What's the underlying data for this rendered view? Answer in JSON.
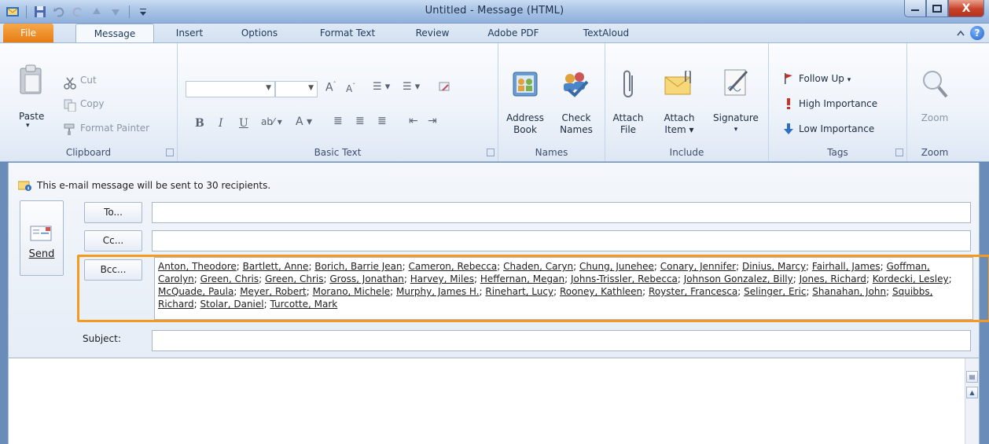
{
  "window": {
    "title": "Untitled - Message (HTML)",
    "close_glyph": "X"
  },
  "tabs": {
    "file": "File",
    "message": "Message",
    "insert": "Insert",
    "options": "Options",
    "format_text": "Format Text",
    "review": "Review",
    "adobe_pdf": "Adobe PDF",
    "textaloud": "TextAloud",
    "help_glyph": "?"
  },
  "ribbon": {
    "clipboard": {
      "label": "Clipboard",
      "paste": "Paste",
      "cut": "Cut",
      "copy": "Copy",
      "format_painter": "Format Painter"
    },
    "basic_text": {
      "label": "Basic Text"
    },
    "names": {
      "label": "Names",
      "address_book_1": "Address",
      "address_book_2": "Book",
      "check_names_1": "Check",
      "check_names_2": "Names"
    },
    "include": {
      "label": "Include",
      "attach_file_1": "Attach",
      "attach_file_2": "File",
      "attach_item_1": "Attach",
      "attach_item_2": "Item",
      "signature": "Signature"
    },
    "tags": {
      "label": "Tags",
      "follow_up": "Follow Up",
      "high_importance": "High Importance",
      "low_importance": "Low Importance"
    },
    "zoom": {
      "label": "Zoom",
      "zoom_btn": "Zoom"
    }
  },
  "compose": {
    "info": "This e-mail message will be sent to 30 recipients.",
    "send": "Send",
    "to_btn": "To...",
    "cc_btn": "Cc...",
    "bcc_btn": "Bcc...",
    "subject_label": "Subject:",
    "bcc_recipients": [
      "Anton, Theodore",
      "Bartlett, Anne",
      "Borich, Barrie Jean",
      "Cameron, Rebecca",
      "Chaden, Caryn",
      "Chung, Junehee",
      "Conary, Jennifer",
      "Dinius, Marcy",
      "Fairhall, James",
      "Goffman, Carolyn",
      "Green, Chris",
      "Green, Chris",
      "Gross, Jonathan",
      "Harvey, Miles",
      "Heffernan, Megan",
      "Johns-Trissler, Rebecca",
      "Johnson Gonzalez, Billy",
      "Jones, Richard",
      "Kordecki, Lesley",
      "McQuade, Paula",
      "Meyer, Robert",
      "Morano, Michele",
      "Murphy, James H.",
      "Rinehart, Lucy",
      "Rooney, Kathleen",
      "Royster, Francesca",
      "Selinger, Eric",
      "Shanahan, John",
      "Squibbs, Richard",
      "Stolar, Daniel",
      "Turcotte, Mark"
    ]
  },
  "colors": {
    "accent_orange": "#f39a1f",
    "file_tab": "#e77c13",
    "ribbon_blue": "#dde7f4"
  }
}
